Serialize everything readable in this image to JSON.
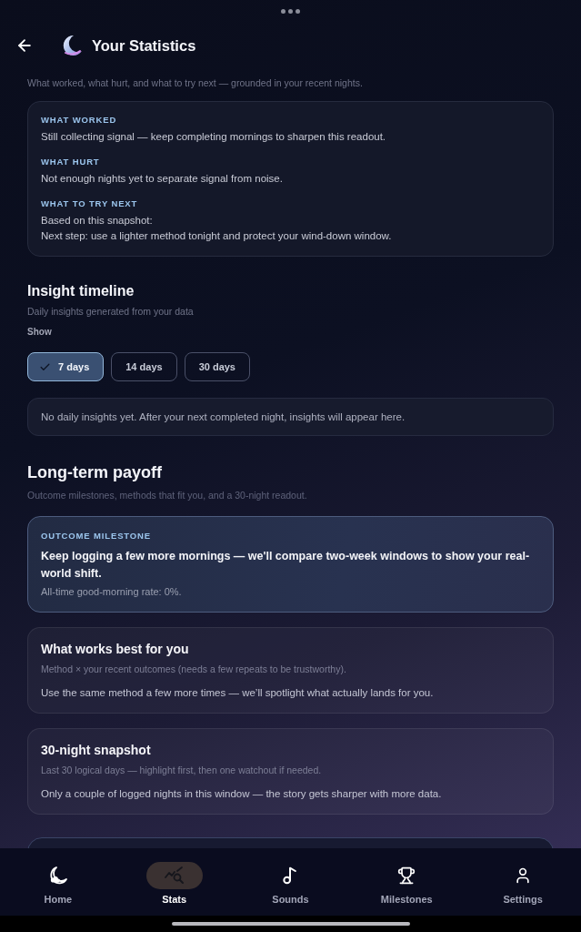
{
  "top_bar": {
    "title": "Your Statistics"
  },
  "reflection": {
    "subtitle": "What worked, what hurt, and what to try next — grounded in your recent nights.",
    "sections": [
      {
        "label": "WHAT WORKED",
        "lines": [
          "Still collecting signal — keep completing mornings to sharpen this readout."
        ]
      },
      {
        "label": "WHAT HURT",
        "lines": [
          "Not enough nights yet to separate signal from noise."
        ]
      },
      {
        "label": "WHAT TO TRY NEXT",
        "lines": [
          "Based on this snapshot:",
          "Next step: use a lighter method tonight and protect your wind-down window."
        ]
      }
    ]
  },
  "insight_timeline": {
    "title": "Insight timeline",
    "subtitle": "Daily insights generated from your data",
    "filter_label": "Show",
    "filters": [
      {
        "label": "7 days",
        "selected": true
      },
      {
        "label": "14 days",
        "selected": false
      },
      {
        "label": "30 days",
        "selected": false
      }
    ],
    "empty_message": "No daily insights yet. After your next completed night, insights will appear here."
  },
  "long_term_payoff": {
    "title": "Long-term payoff",
    "subtitle": "Outcome milestones, methods that fit you, and a 30-night readout.",
    "cards": [
      {
        "kind": "milestone",
        "label": "OUTCOME MILESTONE",
        "headline": "Keep logging a few more mornings — we'll compare two-week windows to show your real-world shift.",
        "note": "All-time good-morning rate: 0%."
      },
      {
        "kind": "info",
        "title": "What works best for you",
        "subtitle": "Method × your recent outcomes (needs a few repeats to be trustworthy).",
        "body": "Use the same method a few more times — we’ll spotlight what actually lands for you."
      },
      {
        "kind": "info",
        "title": "30-night snapshot",
        "subtitle": "Last 30 logical days — highlight first, then one watchout if needed.",
        "body": "Only a couple of logged nights in this window — the story gets sharper with more data."
      }
    ]
  },
  "bottom_nav": [
    {
      "label": "Home",
      "selected": false
    },
    {
      "label": "Stats",
      "selected": true
    },
    {
      "label": "Sounds",
      "selected": false
    },
    {
      "label": "Milestones",
      "selected": false
    },
    {
      "label": "Settings",
      "selected": false
    }
  ]
}
